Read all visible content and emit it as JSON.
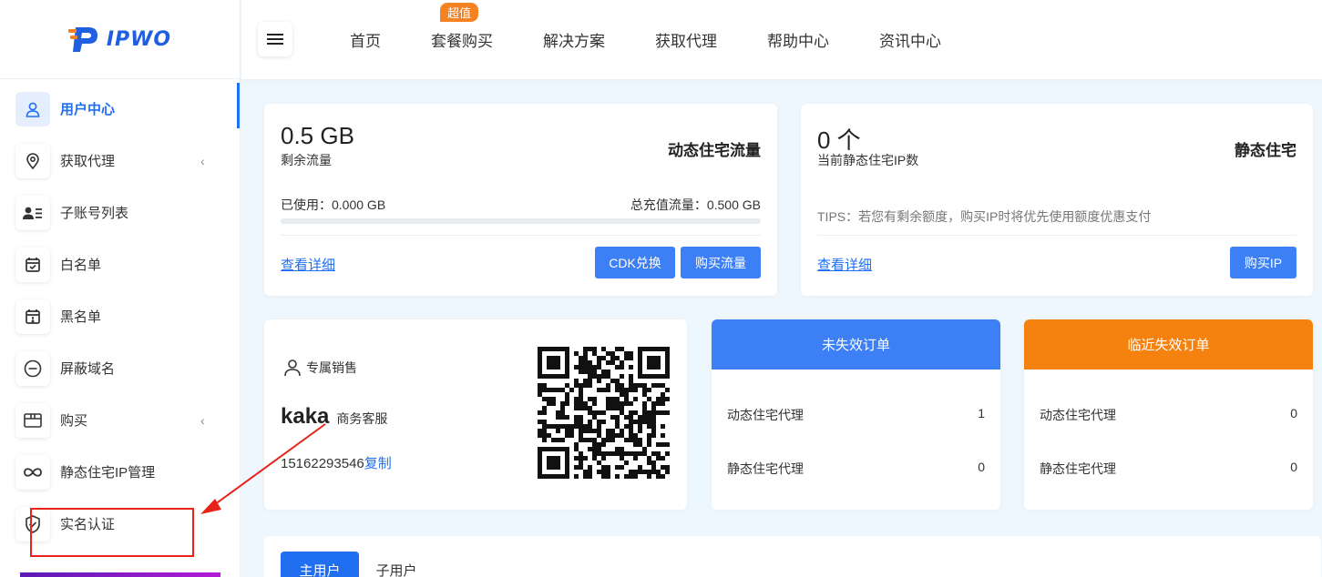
{
  "brand": {
    "name": "IPWO"
  },
  "sidebar": {
    "items": [
      {
        "label": "用户中心",
        "icon": "user-icon",
        "active": true
      },
      {
        "label": "获取代理",
        "icon": "location-pin-icon",
        "expandable": true
      },
      {
        "label": "子账号列表",
        "icon": "contacts-icon"
      },
      {
        "label": "白名单",
        "icon": "calendar-check-icon"
      },
      {
        "label": "黑名单",
        "icon": "calendar-alert-icon"
      },
      {
        "label": "屏蔽域名",
        "icon": "minus-circle-icon"
      },
      {
        "label": "购买",
        "icon": "box-icon",
        "expandable": true
      },
      {
        "label": "静态住宅IP管理",
        "icon": "infinity-icon"
      },
      {
        "label": "实名认证",
        "icon": "shield-check-icon"
      }
    ]
  },
  "topnav": {
    "items": [
      "首页",
      "套餐购买",
      "解决方案",
      "获取代理",
      "帮助中心",
      "资讯中心"
    ],
    "badge": "超值"
  },
  "dynamic_card": {
    "amount": "0.5 GB",
    "amount_label": "剩余流量",
    "title": "动态住宅流量",
    "used": "已使用：0.000 GB",
    "total": "总充值流量：0.500 GB",
    "used_fraction": 0,
    "detail_link": "查看详细",
    "cdk_button": "CDK兑换",
    "buy_button": "购买流量"
  },
  "static_card": {
    "amount": "0 个",
    "amount_label": "当前静态住宅IP数",
    "title": "静态住宅",
    "tips": "TIPS：若您有剩余额度，购买IP时将优先使用额度优惠支付",
    "detail_link": "查看详细",
    "buy_button": "购买IP"
  },
  "sales_card": {
    "title": "专属销售",
    "name": "kaka",
    "role": "商务客服",
    "phone": "15162293546",
    "copy": "复制"
  },
  "active_orders": {
    "title": "未失效订单",
    "color": "#3d7ff5",
    "rows": [
      {
        "label": "动态住宅代理",
        "value": "1"
      },
      {
        "label": "静态住宅代理",
        "value": "0"
      }
    ]
  },
  "expiring_orders": {
    "title": "临近失效订单",
    "color": "#f5820f",
    "rows": [
      {
        "label": "动态住宅代理",
        "value": "0"
      },
      {
        "label": "静态住宅代理",
        "value": "0"
      }
    ]
  },
  "tabs": [
    "主用户",
    "子用户"
  ]
}
